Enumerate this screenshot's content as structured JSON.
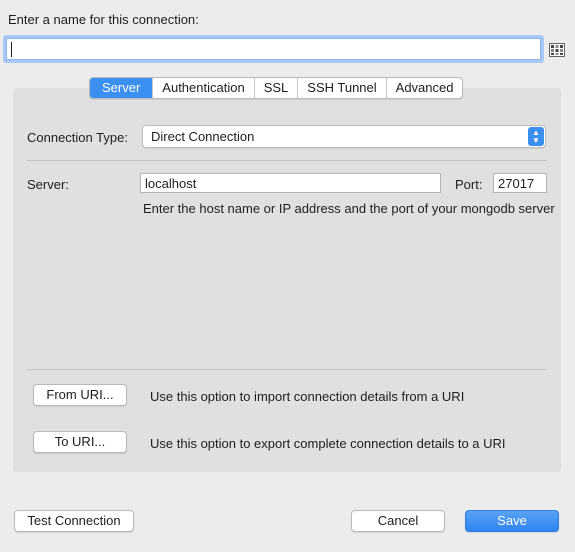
{
  "connection_name": {
    "label": "Enter a name for this connection:",
    "value": ""
  },
  "tabs": [
    {
      "label": "Server",
      "active": true
    },
    {
      "label": "Authentication",
      "active": false
    },
    {
      "label": "SSL",
      "active": false
    },
    {
      "label": "SSH Tunnel",
      "active": false
    },
    {
      "label": "Advanced",
      "active": false
    }
  ],
  "server_tab": {
    "connection_type_label": "Connection Type:",
    "connection_type_value": "Direct Connection",
    "server_label": "Server:",
    "server_value": "localhost",
    "port_label": "Port:",
    "port_value": "27017",
    "hint": "Enter the host name or IP address and the port of your mongodb server"
  },
  "uri": {
    "from_label": "From URI...",
    "from_desc": "Use this option to import connection details from a URI",
    "to_label": "To URI...",
    "to_desc": "Use this option to export complete connection details to a URI"
  },
  "footer": {
    "test_label": "Test Connection",
    "cancel_label": "Cancel",
    "save_label": "Save"
  },
  "colors": {
    "accent": "#3b8ff0",
    "panel": "#e0e0e0",
    "window": "#ececec"
  }
}
